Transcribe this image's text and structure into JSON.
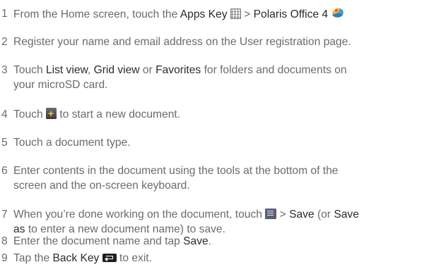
{
  "steps": [
    {
      "number": "1",
      "parts": [
        "From the Home screen, touch the ",
        "Apps Key",
        " > ",
        "Polaris Office 4"
      ]
    },
    {
      "number": "2",
      "line1": "Register your name and email address on the User registration page."
    },
    {
      "number": "3",
      "parts": [
        "Touch ",
        "List view",
        ", ",
        "Grid view",
        " or ",
        "Favorites",
        " for folders and documents on"
      ],
      "line2": "your microSD card."
    },
    {
      "number": "4",
      "parts": [
        "Touch ",
        " to start a new document."
      ]
    },
    {
      "number": "5",
      "line1": "Touch a document type."
    },
    {
      "number": "6",
      "line1": "Enter contents in the document using the tools at the bottom of the",
      "line2": "screen and the on-screen keyboard."
    },
    {
      "number": "7",
      "parts": [
        "When you’re done working on the document, touch ",
        " > ",
        "Save",
        " (or ",
        "Save"
      ],
      "line2_parts": [
        "as",
        " to enter a new document name) to save."
      ]
    },
    {
      "number": "8",
      "parts": [
        "Enter the document name and tap ",
        "Save",
        "."
      ]
    },
    {
      "number": "9",
      "parts": [
        "Tap the ",
        "Back Key",
        " ",
        " to exit."
      ]
    }
  ]
}
